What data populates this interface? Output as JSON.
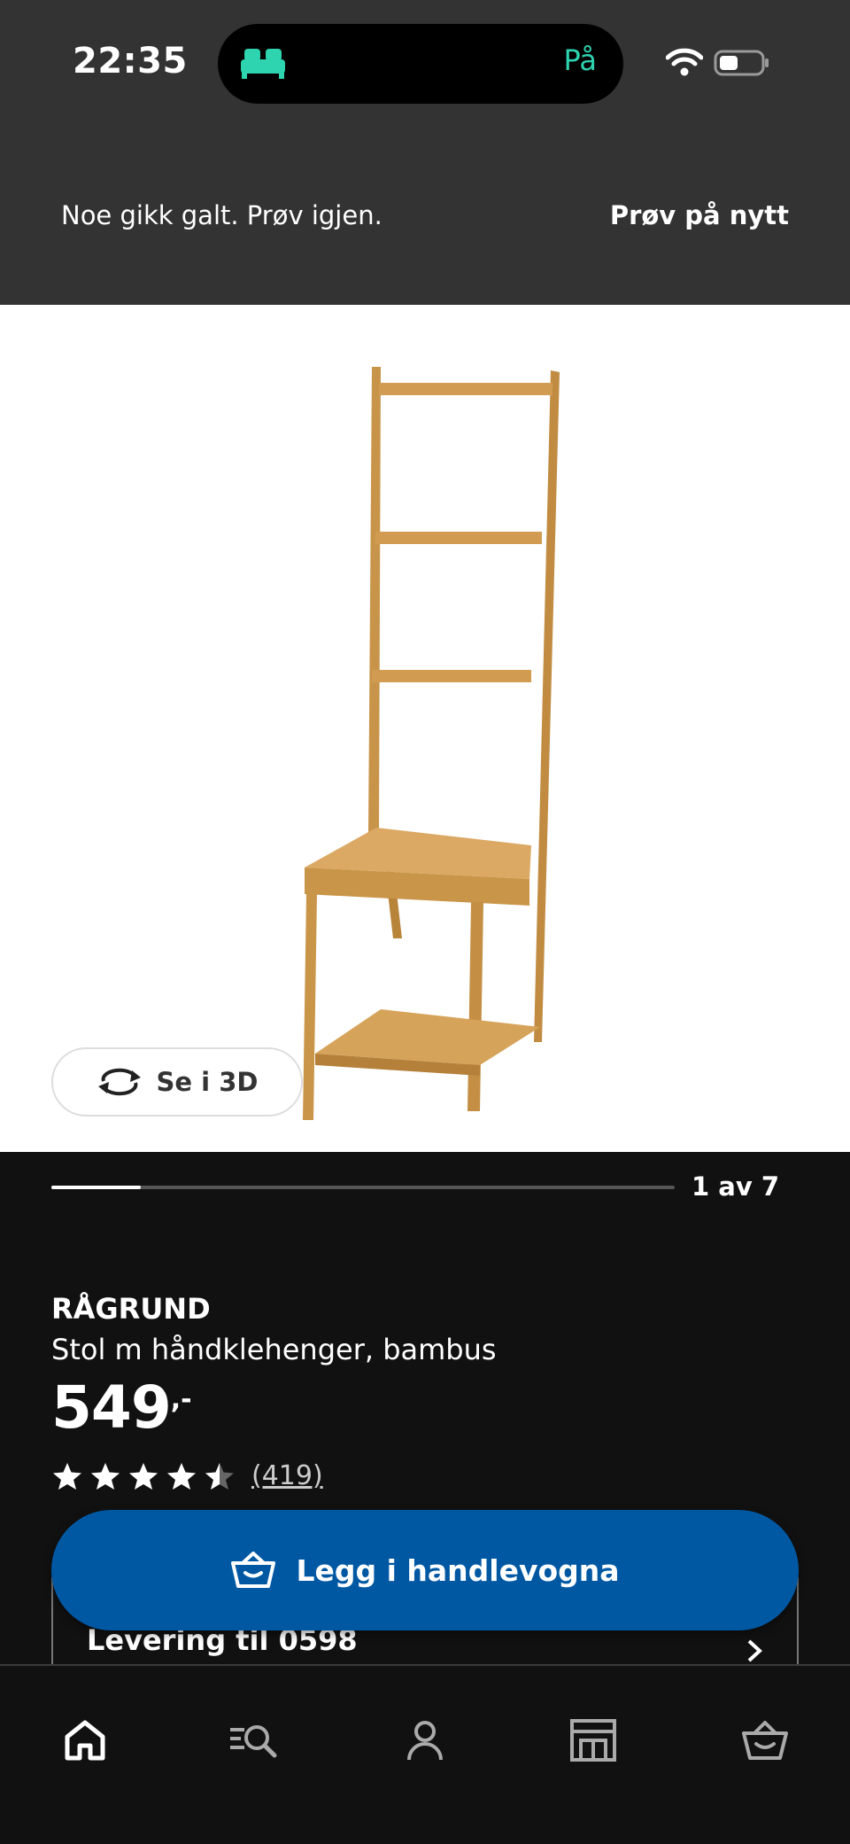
{
  "status_bar": {
    "time": "22:35",
    "live_activity_text": "På",
    "icons": [
      "bed-icon",
      "wifi-icon",
      "battery-icon"
    ]
  },
  "error_banner": {
    "message": "Noe gikk galt. Prøv igjen.",
    "retry_label": "Prøv på nytt"
  },
  "gallery": {
    "view_3d_label": "Se i 3D",
    "page_indicator": "1 av 7",
    "current_index": 1,
    "total": 7
  },
  "product": {
    "name": "RÅGRUND",
    "description": "Stol m håndklehenger, bambus",
    "price_integer": "549",
    "price_decimal": ",-",
    "rating": 4.5,
    "rating_max": 5,
    "review_count": "(419)"
  },
  "delivery": {
    "label": "Levering til 0598"
  },
  "actions": {
    "add_to_cart_label": "Legg i handlevogna"
  },
  "bottom_nav": {
    "items": [
      "home-icon",
      "search-icon",
      "account-icon",
      "store-icon",
      "cart-icon"
    ]
  },
  "colors": {
    "primary_blue": "#0058a3",
    "background": "#111111",
    "header_background": "#333333",
    "live_activity": "#2ed3b0"
  }
}
